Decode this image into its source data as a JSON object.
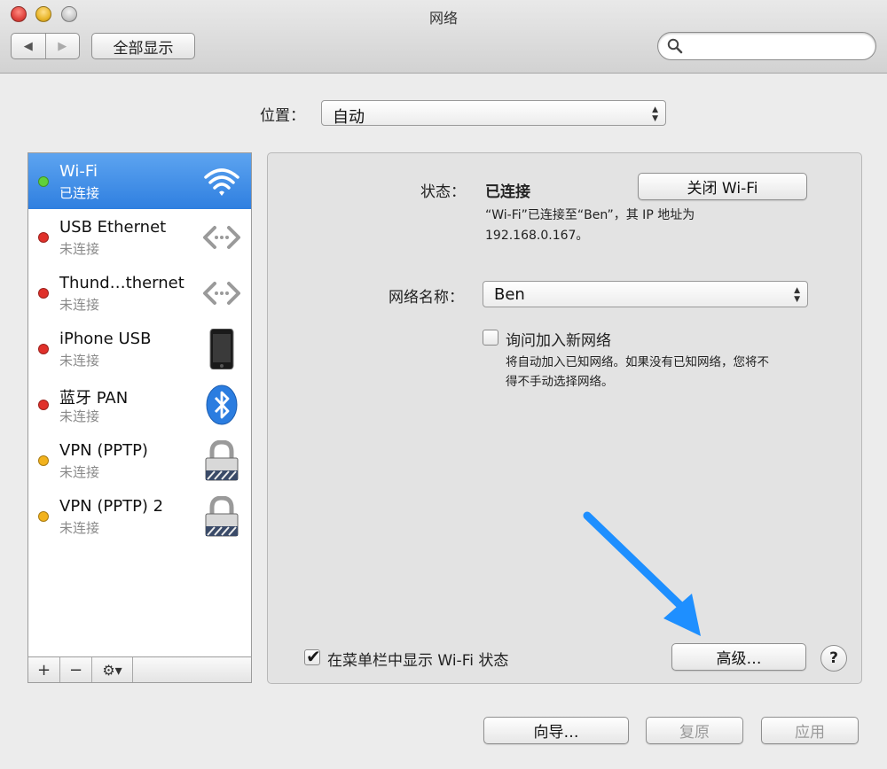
{
  "window": {
    "title": "网络"
  },
  "toolbar": {
    "back_label": "◀",
    "forward_label": "▶",
    "show_all_label": "全部显示",
    "search_value": "",
    "search_placeholder": ""
  },
  "location": {
    "label": "位置：",
    "value": "自动"
  },
  "services": [
    {
      "name": "Wi-Fi",
      "status": "已连接",
      "status_color": "#5fd13b",
      "icon": "wifi-icon",
      "selected": true
    },
    {
      "name": "USB Ethernet",
      "status": "未连接",
      "status_color": "#e0302a",
      "icon": "ethernet-icon",
      "selected": false
    },
    {
      "name": "Thund…thernet",
      "status": "未连接",
      "status_color": "#e0302a",
      "icon": "ethernet-icon",
      "selected": false
    },
    {
      "name": "iPhone USB",
      "status": "未连接",
      "status_color": "#e0302a",
      "icon": "iphone-icon",
      "selected": false
    },
    {
      "name": "蓝牙 PAN",
      "status": "未连接",
      "status_color": "#e0302a",
      "icon": "bluetooth-icon",
      "selected": false
    },
    {
      "name": "VPN (PPTP)",
      "status": "未连接",
      "status_color": "#f2b21c",
      "icon": "lock-icon",
      "selected": false
    },
    {
      "name": "VPN (PPTP) 2",
      "status": "未连接",
      "status_color": "#f2b21c",
      "icon": "lock-icon",
      "selected": false
    }
  ],
  "sidebar_buttons": {
    "add": "+",
    "remove": "−",
    "gear": "⚙▾"
  },
  "detail": {
    "status_label": "状态：",
    "status_value": "已连接",
    "turn_off_button": "关闭 Wi-Fi",
    "status_desc_line1": "“Wi-Fi”已连接至“Ben”，其 IP 地址为",
    "status_desc_line2": "192.168.0.167。",
    "network_name_label": "网络名称：",
    "network_name_value": "Ben",
    "ask_join_label": "询问加入新网络",
    "ask_join_checked": false,
    "ask_join_desc_line1": "将自动加入已知网络。如果没有已知网络，您将不",
    "ask_join_desc_line2": "得不手动选择网络。",
    "show_menubar_label": "在菜单栏中显示 Wi-Fi 状态",
    "show_menubar_checked": true,
    "advanced_button": "高级…",
    "help_button": "?"
  },
  "bottom": {
    "assist_button": "向导…",
    "revert_button": "复原",
    "apply_button": "应用"
  },
  "colors": {
    "selection": "#3a8ae6",
    "annotation_arrow": "#1e8fff"
  }
}
